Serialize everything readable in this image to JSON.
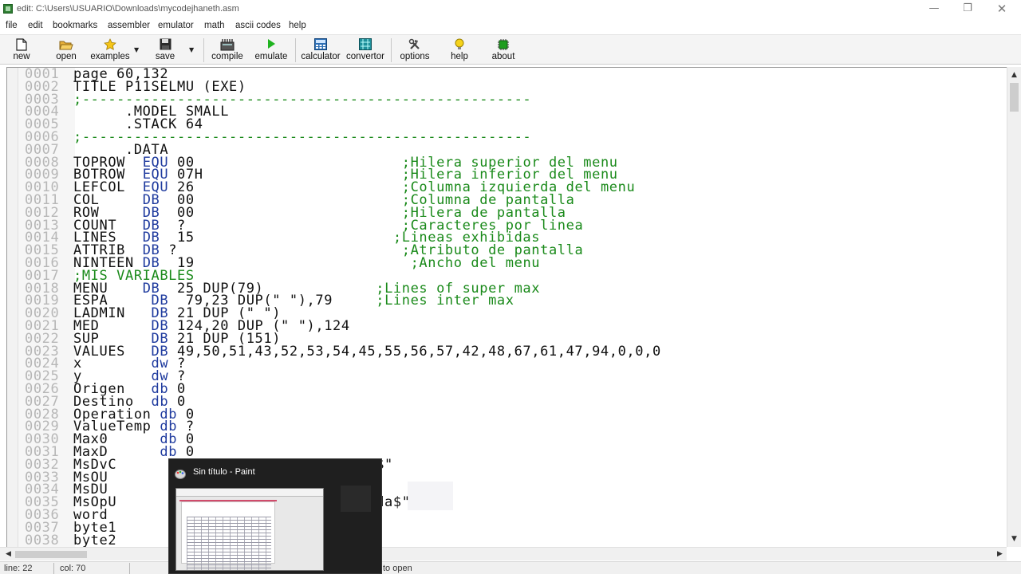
{
  "window": {
    "title": "edit: C:\\Users\\USUARIO\\Downloads\\mycodejhaneth.asm",
    "minimize": "—",
    "maximize": "❐",
    "close": "✕"
  },
  "menu": [
    "file",
    "edit",
    "bookmarks",
    "assembler",
    "emulator",
    "math",
    "ascii codes",
    "help"
  ],
  "toolbar": {
    "new": "new",
    "open": "open",
    "examples": "examples",
    "save": "save",
    "compile": "compile",
    "emulate": "emulate",
    "calculator": "calculator",
    "convertor": "convertor",
    "options": "options",
    "help": "help",
    "about": "about"
  },
  "colors": {
    "keyword": "#1e3a9e",
    "comment": "#1a8a1a",
    "line_number": "#b7b7b7"
  },
  "code_lines": [
    {
      "num": "0001",
      "parts": [
        [
          "t",
          "page 60,132"
        ]
      ]
    },
    {
      "num": "0002",
      "parts": [
        [
          "t",
          "TITLE P11SELMU (EXE)"
        ]
      ]
    },
    {
      "num": "0003",
      "parts": [
        [
          "c",
          ";----------------------------------------------------"
        ]
      ]
    },
    {
      "num": "0004",
      "parts": [
        [
          "t",
          "      .MODEL SMALL"
        ]
      ]
    },
    {
      "num": "0005",
      "parts": [
        [
          "t",
          "      .STACK 64"
        ]
      ]
    },
    {
      "num": "0006",
      "parts": [
        [
          "c",
          ";----------------------------------------------------"
        ]
      ]
    },
    {
      "num": "0007",
      "parts": [
        [
          "t",
          "      .DATA"
        ]
      ]
    },
    {
      "num": "0008",
      "parts": [
        [
          "t",
          "TOPROW  "
        ],
        [
          "k",
          "EQU"
        ],
        [
          "t",
          " 00                        "
        ],
        [
          "c",
          ";Hilera superior del menu"
        ]
      ]
    },
    {
      "num": "0009",
      "parts": [
        [
          "t",
          "BOTROW  "
        ],
        [
          "k",
          "EQU"
        ],
        [
          "t",
          " 07H                       "
        ],
        [
          "c",
          ";Hilera inferior del menu"
        ]
      ]
    },
    {
      "num": "0010",
      "parts": [
        [
          "t",
          "LEFCOL  "
        ],
        [
          "k",
          "EQU"
        ],
        [
          "t",
          " 26                        "
        ],
        [
          "c",
          ";Columna izquierda del menu"
        ]
      ]
    },
    {
      "num": "0011",
      "parts": [
        [
          "t",
          "COL     "
        ],
        [
          "k",
          "DB"
        ],
        [
          "t",
          "  00                        "
        ],
        [
          "c",
          ";Columna de pantalla"
        ]
      ]
    },
    {
      "num": "0012",
      "parts": [
        [
          "t",
          "ROW     "
        ],
        [
          "k",
          "DB"
        ],
        [
          "t",
          "  00                        "
        ],
        [
          "c",
          ";Hilera de pantalla"
        ]
      ]
    },
    {
      "num": "0013",
      "parts": [
        [
          "t",
          "COUNT   "
        ],
        [
          "k",
          "DB"
        ],
        [
          "t",
          "  ?                         "
        ],
        [
          "c",
          ";Caracteres por linea"
        ]
      ]
    },
    {
      "num": "0014",
      "parts": [
        [
          "t",
          "LINES   "
        ],
        [
          "k",
          "DB"
        ],
        [
          "t",
          "  15                       "
        ],
        [
          "c",
          ";Lineas exhibidas"
        ]
      ]
    },
    {
      "num": "0015",
      "parts": [
        [
          "t",
          "ATTRIB  "
        ],
        [
          "k",
          "DB"
        ],
        [
          "t",
          " ?                          "
        ],
        [
          "c",
          ";Atributo de pantalla"
        ]
      ]
    },
    {
      "num": "0016",
      "parts": [
        [
          "t",
          "NINTEEN "
        ],
        [
          "k",
          "DB"
        ],
        [
          "t",
          "  19                        "
        ],
        [
          "c",
          " ;Ancho del menu"
        ]
      ]
    },
    {
      "num": "0017",
      "parts": [
        [
          "c",
          ";MIS VARIABLES"
        ]
      ]
    },
    {
      "num": "0018",
      "parts": [
        [
          "t",
          "MENU    "
        ],
        [
          "k",
          "DB"
        ],
        [
          "t",
          "  25 DUP(79)             "
        ],
        [
          "c",
          ";Lines of super max"
        ]
      ]
    },
    {
      "num": "0019",
      "parts": [
        [
          "t",
          "ESPA     "
        ],
        [
          "k",
          "DB"
        ],
        [
          "t",
          "  79,23 DUP(\" \"),79     "
        ],
        [
          "c",
          ";Lines inter max"
        ]
      ]
    },
    {
      "num": "0020",
      "parts": [
        [
          "t",
          "LADMIN   "
        ],
        [
          "k",
          "DB"
        ],
        [
          "t",
          " 21 DUP (\" \")"
        ]
      ]
    },
    {
      "num": "0021",
      "parts": [
        [
          "t",
          "MED      "
        ],
        [
          "k",
          "DB"
        ],
        [
          "t",
          " 124,20 DUP (\" \"),124"
        ]
      ]
    },
    {
      "num": "0022",
      "parts": [
        [
          "t",
          "SUP      "
        ],
        [
          "k",
          "DB"
        ],
        [
          "t",
          " 21 DUP (151)"
        ]
      ]
    },
    {
      "num": "0023",
      "parts": [
        [
          "t",
          "VALUES   "
        ],
        [
          "k",
          "DB"
        ],
        [
          "t",
          " 49,50,51,43,52,53,54,45,55,56,57,42,48,67,61,47,94,0,0,0"
        ]
      ]
    },
    {
      "num": "0024",
      "parts": [
        [
          "t",
          "x        "
        ],
        [
          "k",
          "dw"
        ],
        [
          "t",
          " ?"
        ]
      ]
    },
    {
      "num": "0025",
      "parts": [
        [
          "t",
          "y        "
        ],
        [
          "k",
          "dw"
        ],
        [
          "t",
          " ?"
        ]
      ]
    },
    {
      "num": "0026",
      "parts": [
        [
          "t",
          "Origen   "
        ],
        [
          "k",
          "db"
        ],
        [
          "t",
          " 0"
        ]
      ]
    },
    {
      "num": "0027",
      "parts": [
        [
          "t",
          "Destino  "
        ],
        [
          "k",
          "db"
        ],
        [
          "t",
          " 0"
        ]
      ]
    },
    {
      "num": "0028",
      "parts": [
        [
          "t",
          "Operation "
        ],
        [
          "k",
          "db"
        ],
        [
          "t",
          " 0"
        ]
      ]
    },
    {
      "num": "0029",
      "parts": [
        [
          "t",
          "ValueTemp "
        ],
        [
          "k",
          "db"
        ],
        [
          "t",
          " ?"
        ]
      ]
    },
    {
      "num": "0030",
      "parts": [
        [
          "t",
          "Max0      "
        ],
        [
          "k",
          "db"
        ],
        [
          "t",
          " 0"
        ]
      ]
    },
    {
      "num": "0031",
      "parts": [
        [
          "t",
          "MaxD      "
        ],
        [
          "k",
          "db"
        ],
        [
          "t",
          " 0"
        ]
      ]
    },
    {
      "num": "0032",
      "parts": [
        [
          "t",
          "MsDvC                             o$\""
        ]
      ]
    },
    {
      "num": "0033",
      "parts": [
        [
          "t",
          "MsOU                              $\""
        ]
      ]
    },
    {
      "num": "0034",
      "parts": [
        [
          "t",
          "MsDU                              $\""
        ]
      ]
    },
    {
      "num": "0035",
      "parts": [
        [
          "t",
          "MsOpU                             ida$\""
        ]
      ]
    },
    {
      "num": "0036",
      "parts": [
        [
          "t",
          "word"
        ]
      ]
    },
    {
      "num": "0037",
      "parts": [
        [
          "t",
          "byte1"
        ]
      ]
    },
    {
      "num": "0038",
      "parts": [
        [
          "t",
          "byte2"
        ]
      ]
    }
  ],
  "status": {
    "line": "line: 22",
    "col": "col: 70",
    "hint": "to open"
  },
  "popup": {
    "title": "Sin título - Paint"
  },
  "scroll": {
    "up": "▲",
    "down": "▼",
    "left": "◀",
    "right": "▶"
  }
}
